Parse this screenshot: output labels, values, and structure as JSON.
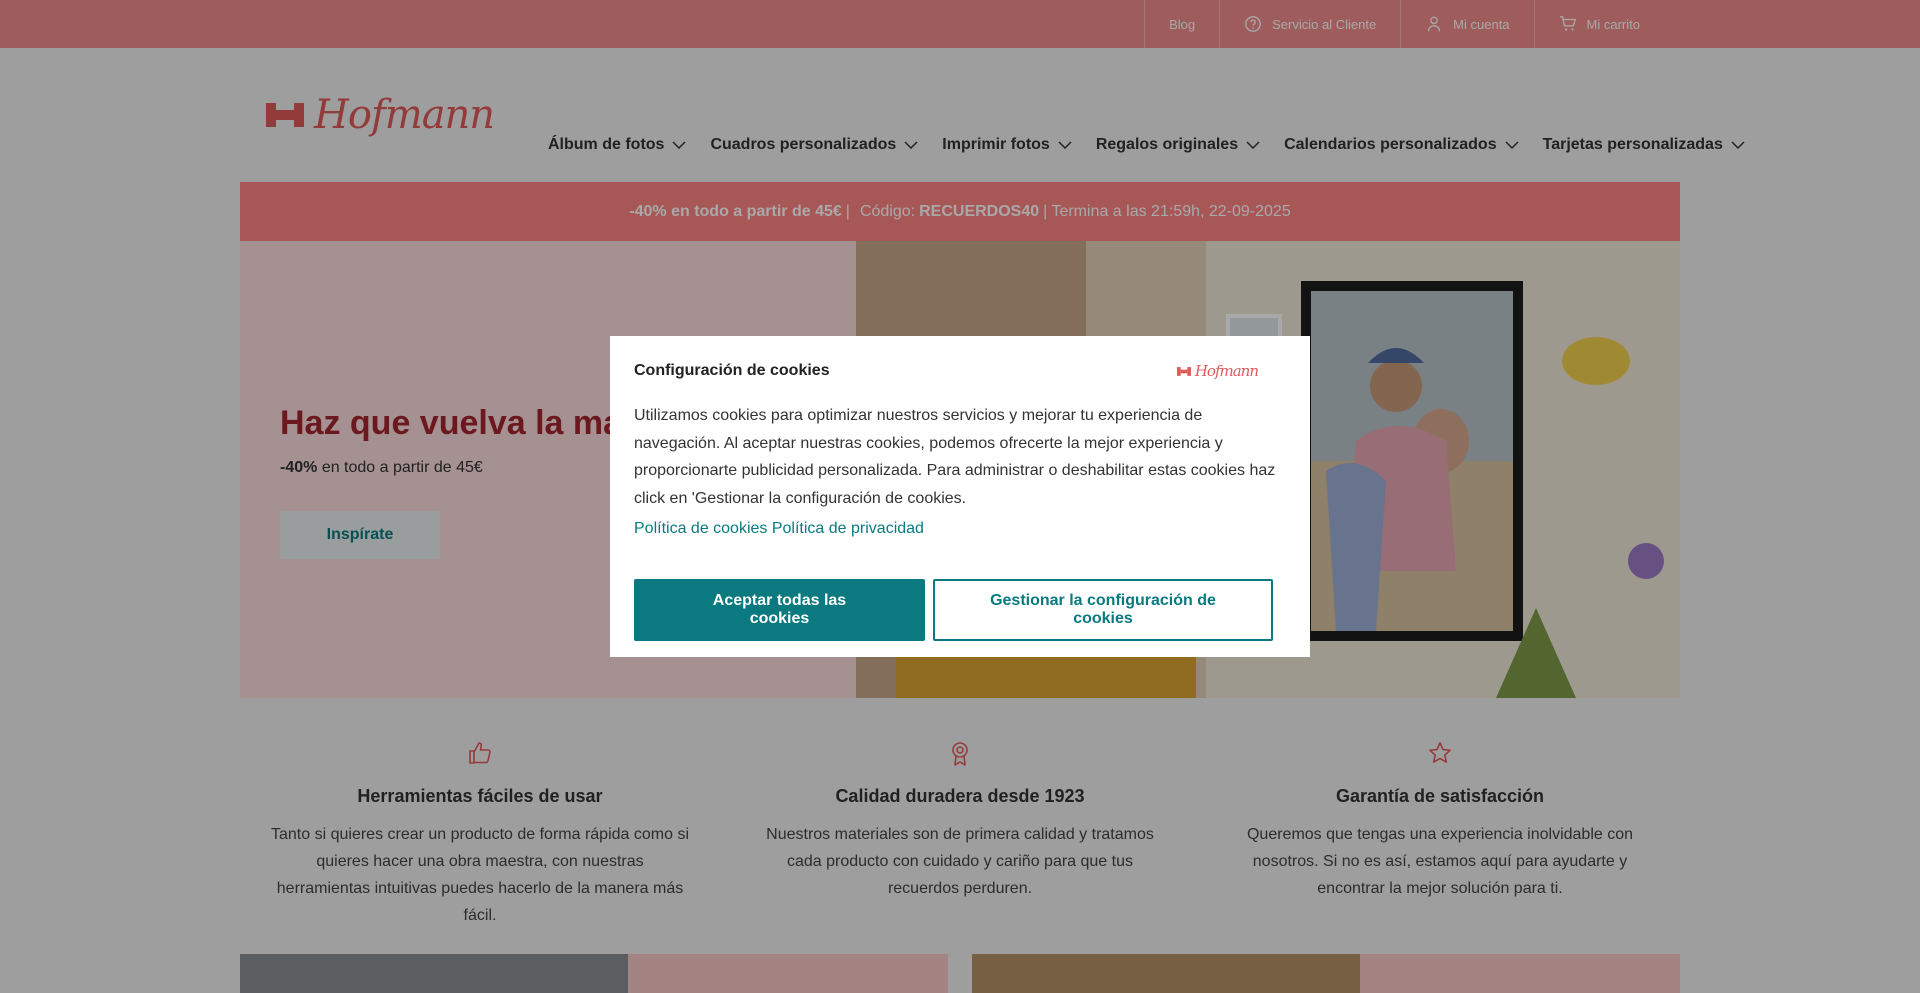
{
  "topbar": {
    "links": [
      {
        "label": "Blog",
        "icon": "none"
      },
      {
        "label": "Servicio al Cliente",
        "icon": "help-circle-icon"
      },
      {
        "label": "Mi cuenta",
        "icon": "user-icon"
      },
      {
        "label": "Mi carrito",
        "icon": "cart-icon"
      }
    ]
  },
  "brand": {
    "name": "Hofmann"
  },
  "nav": {
    "items": [
      "Álbum de fotos",
      "Cuadros personalizados",
      "Imprimir fotos",
      "Regalos originales",
      "Calendarios personalizados",
      "Tarjetas personalizadas"
    ]
  },
  "promo": {
    "discount": "-40% en todo a partir de 45€",
    "separator": "|",
    "code_label": "Código:",
    "code": "RECUERDOS40",
    "ends": "| Termina a las 21:59h, 22-09-2025"
  },
  "hero": {
    "title": "Haz que vuelva la magia",
    "sub_bold": "-40%",
    "sub_rest": "en todo a partir de 45€",
    "button": "Inspírate"
  },
  "features": [
    {
      "icon": "thumbs-up-icon",
      "title": "Herramientas fáciles de usar",
      "text": "Tanto si quieres crear un producto de forma rápida como si quieres hacer una obra maestra, con nuestras herramientas intuitivas puedes hacerlo de la manera más fácil."
    },
    {
      "icon": "award-icon",
      "title": "Calidad duradera desde 1923",
      "text": "Nuestros materiales son de primera calidad y tratamos cada producto con cuidado y cariño para que tus recuerdos perduren."
    },
    {
      "icon": "star-icon",
      "title": "Garantía de satisfacción",
      "text": "Queremos que tengas una experiencia inolvidable con nosotros. Si no es así, estamos aquí para ayudarte y encontrar la mejor solución para ti."
    }
  ],
  "cookie_modal": {
    "title": "Configuración de cookies",
    "body": "Utilizamos cookies para optimizar nuestros servicios y mejorar tu experiencia de navegación. Al aceptar nuestras cookies, podemos ofrecerte la mejor experiencia y proporcionarte publicidad personalizada. Para administrar o deshabilitar estas cookies haz click en 'Gestionar la configuración de cookies.",
    "link_cookies": "Política de cookies",
    "link_privacy": "Política de privacidad",
    "accept_button": "Aceptar todas las cookies",
    "manage_button": "Gestionar la configuración de cookies"
  },
  "colors": {
    "topbar": "#f28c8c",
    "promo": "#ff8585",
    "brand_red": "#e05a5a",
    "hero_title": "#a3262f",
    "teal": "#0a7a80"
  }
}
